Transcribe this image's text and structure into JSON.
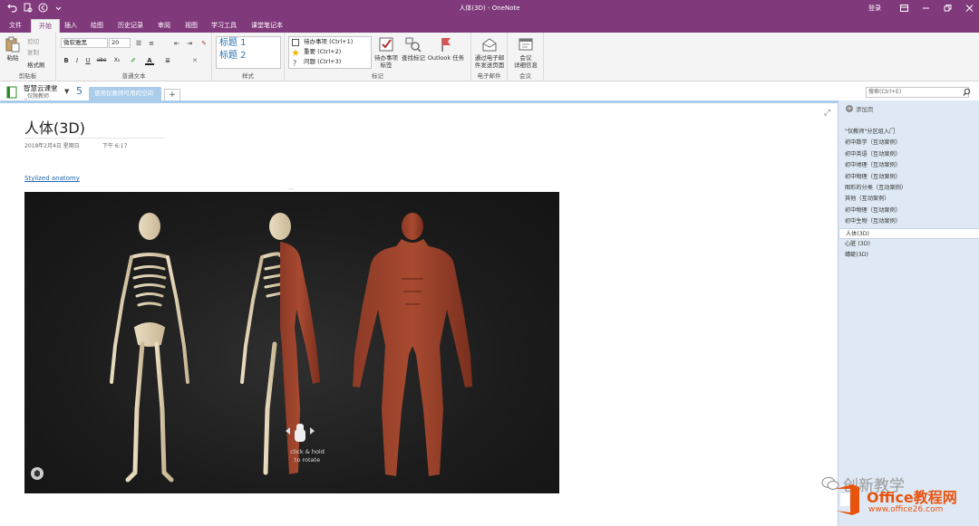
{
  "window": {
    "title": "人体(3D) - OneNote",
    "login": "登录"
  },
  "tabs": [
    "文件",
    "开始",
    "插入",
    "绘图",
    "历史记录",
    "审阅",
    "视图",
    "学习工具",
    "课堂笔记本"
  ],
  "ribbon": {
    "clipboard": {
      "paste": "粘贴",
      "cut": "剪切",
      "copy": "复制",
      "format_painter": "格式刷",
      "label": "剪贴板"
    },
    "basic_text": {
      "font": "微软雅黑",
      "size": "20",
      "bold": "B",
      "italic": "I",
      "underline": "U",
      "strike": "abc",
      "subscript": "X₂",
      "label": "普通文本"
    },
    "styles": {
      "heading1": "标题 1",
      "heading2": "标题 2",
      "label": "样式"
    },
    "tags": {
      "todo": "待办事项 (Ctrl+1)",
      "important": "重要 (Ctrl+2)",
      "question": "问题 (Ctrl+3)",
      "todo_tag_l1": "待办事项",
      "todo_tag_l2": "标签",
      "find_tags": "查找标记",
      "outlook_l1": "Outlook 任务",
      "label": "标记"
    },
    "email": {
      "btn_l1": "通过电子邮",
      "btn_l2": "件发送页面",
      "label": "电子邮件"
    },
    "meetings": {
      "btn_l1": "会议",
      "btn_l2": "详细信息",
      "label": "会议"
    }
  },
  "notebook": {
    "name": "智慧云课堂",
    "sub": "_仅限教师",
    "section_number": "5",
    "section_tab": "使用仅教师可用的空间"
  },
  "search": {
    "placeholder": "搜索(Ctrl+E)"
  },
  "page": {
    "title": "人体(3D)",
    "date": "2018年2月4日 星期日",
    "time": "下午 6:17",
    "link": "Stylized anatomy",
    "viewer_hint_l1": "click & hold",
    "viewer_hint_l2": "to rotate"
  },
  "pages_panel": {
    "add_page": "添加页",
    "items": [
      "\"仅教师\"分区组入门",
      "初中数学（互动案例）",
      "初中英语（互动案例）",
      "初中地理（互动案例）",
      "初中物理（互动案例）",
      "图形的分类（互动案例）",
      "其他（互动案例）",
      "初中物理（互动案例）",
      "初中生物（互动案例）",
      "人体(3D)",
      "心脏 (3D)",
      "蜻蜓(3D)"
    ],
    "selected_index": 9
  },
  "watermark": {
    "wechat": "创新教学",
    "brand_a": "Office",
    "brand_b": "教程网",
    "url": "www.office26.com"
  },
  "colors": {
    "accent": "#80397b",
    "section_tab": "#a9cdea",
    "pages_panel": "#dfe9f5",
    "link": "#1f66b0",
    "heading": "#2e74b5"
  }
}
